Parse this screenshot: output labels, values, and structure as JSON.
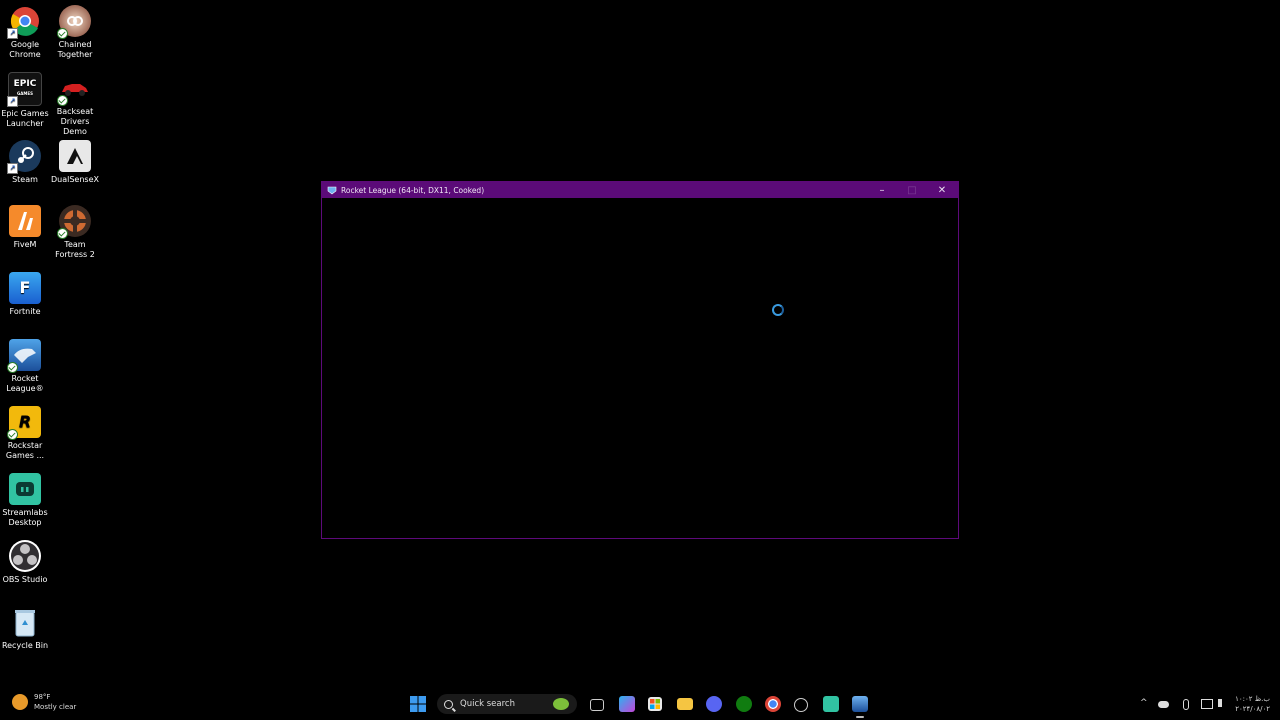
{
  "desktop": {
    "icons": [
      {
        "label": "Google Chrome"
      },
      {
        "label": "Chained Together"
      },
      {
        "label": "Epic Games Launcher"
      },
      {
        "label": "Backseat Drivers Demo"
      },
      {
        "label": "Steam"
      },
      {
        "label": "DualSenseX"
      },
      {
        "label": "FiveM"
      },
      {
        "label": "Team Fortress 2"
      },
      {
        "label": "Fortnite"
      },
      {
        "label": "Rocket League®"
      },
      {
        "label": "Rockstar Games ..."
      },
      {
        "label": "Streamlabs Desktop"
      },
      {
        "label": "OBS Studio"
      },
      {
        "label": "Recycle Bin"
      }
    ],
    "glyphs": {
      "epic": "EPIC",
      "epic_sub": "GAMES",
      "fortnite": "F",
      "rockstar": "R"
    }
  },
  "window": {
    "title": "Rocket League (64-bit, DX11, Cooked)",
    "minimize": "–",
    "maximize": "□",
    "close": "✕"
  },
  "taskbar": {
    "weather_temp": "98°F",
    "weather_desc": "Mostly clear",
    "search_placeholder": "Quick search",
    "tray_chevron": "^",
    "clock_time": "۱۰:۰۲ ب.ظ",
    "clock_date": "۲۰۲۴/۰۸/۰۲"
  },
  "colors": {
    "title_bar": "#5b0b78",
    "spinner": "#3a9be0"
  }
}
